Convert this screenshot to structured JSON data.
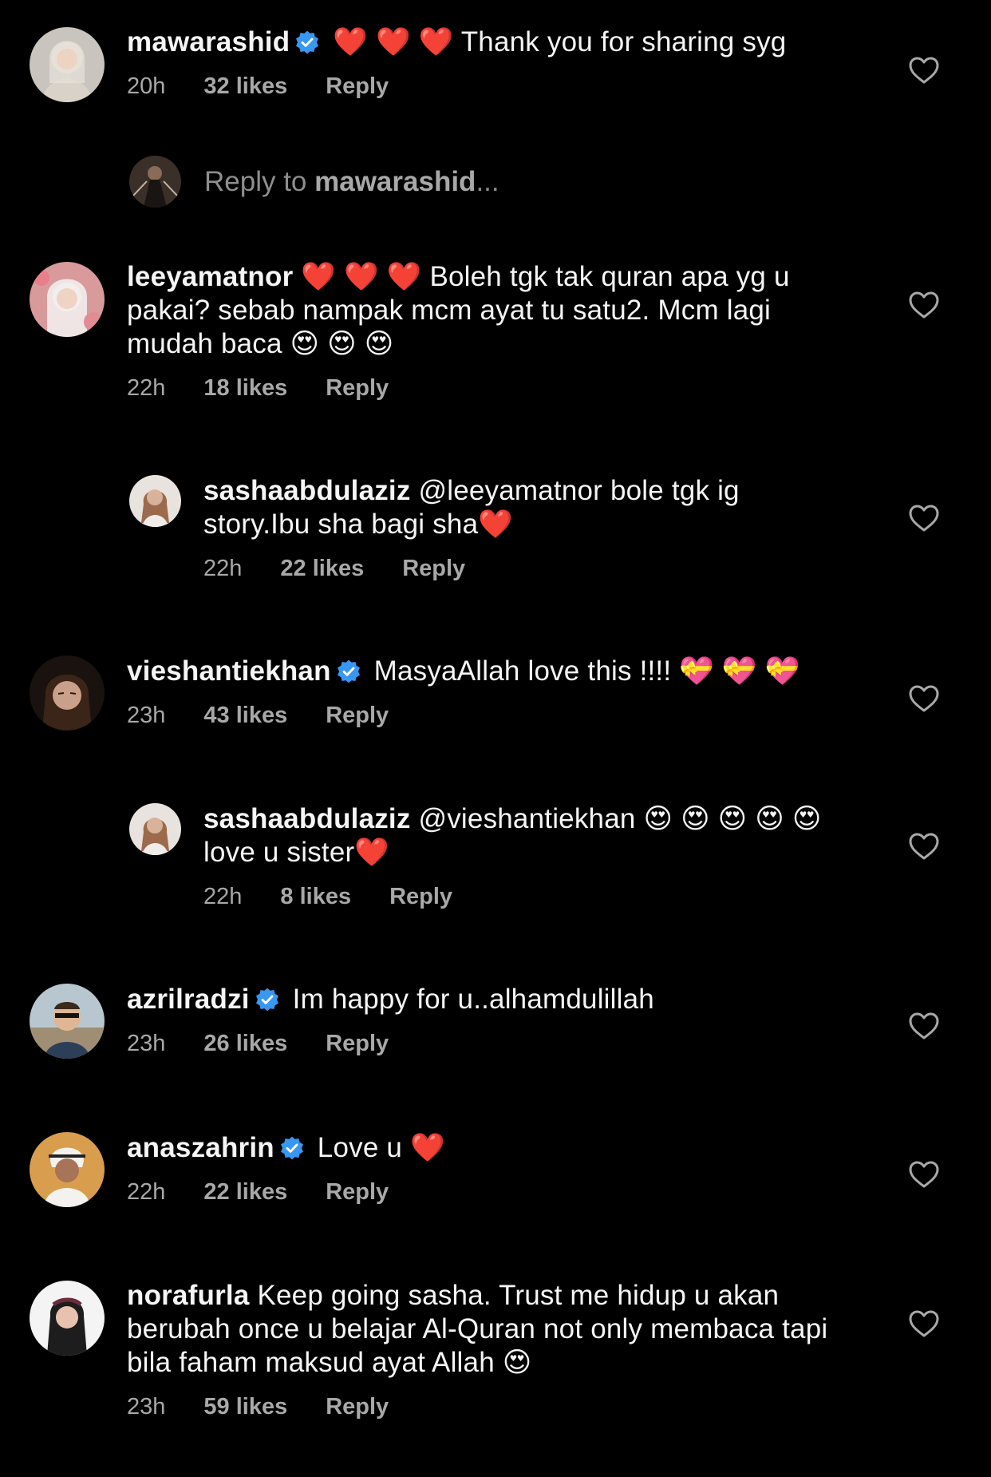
{
  "colors": {
    "background": "#000000",
    "text": "#f5f5f5",
    "meta": "#a8a8a8",
    "verified": "#3897f0",
    "heart_emoji": "#e0245e"
  },
  "comments": [
    {
      "username": "mawarashid",
      "verified": true,
      "text": "❤️ ❤️ ❤️ Thank you for sharing syg",
      "time": "20h",
      "likes": "32 likes",
      "reply": "Reply"
    },
    {
      "username": "leeyamatnor",
      "verified": false,
      "text": "❤️ ❤️ ❤️ Boleh tgk tak quran apa yg u pakai? sebab nampak mcm ayat tu satu2. Mcm lagi mudah baca 😍 😍 😍",
      "time": "22h",
      "likes": "18 likes",
      "reply": "Reply"
    },
    {
      "username": "sashaabdulaziz",
      "verified": false,
      "text": "@leeyamatnor bole tgk ig story.Ibu sha bagi sha❤️",
      "time": "22h",
      "likes": "22 likes",
      "reply": "Reply"
    },
    {
      "username": "vieshantiekhan",
      "verified": true,
      "text": "MasyaAllah love this !!!! 💝 💝 💝",
      "time": "23h",
      "likes": "43 likes",
      "reply": "Reply"
    },
    {
      "username": "sashaabdulaziz",
      "verified": false,
      "text": "@vieshantiekhan 😍 😍 😍 😍 😍love u sister❤️",
      "time": "22h",
      "likes": "8 likes",
      "reply": "Reply"
    },
    {
      "username": "azrilradzi",
      "verified": true,
      "text": "Im happy for u..alhamdulillah",
      "time": "23h",
      "likes": "26 likes",
      "reply": "Reply"
    },
    {
      "username": "anaszahrin",
      "verified": true,
      "text": "Love u ❤️",
      "time": "22h",
      "likes": "22 likes",
      "reply": "Reply"
    },
    {
      "username": "norafurla",
      "verified": false,
      "text": "Keep going sasha. Trust me hidup u akan berubah once u belajar Al-Quran not only membaca tapi bila faham maksud ayat Allah 😍",
      "time": "23h",
      "likes": "59 likes",
      "reply": "Reply"
    }
  ],
  "reply_compose": {
    "prefix": "Reply to ",
    "target": "mawarashid",
    "suffix": "..."
  },
  "icons": {
    "like": "heart-outline-icon",
    "verified": "verified-badge-icon"
  }
}
